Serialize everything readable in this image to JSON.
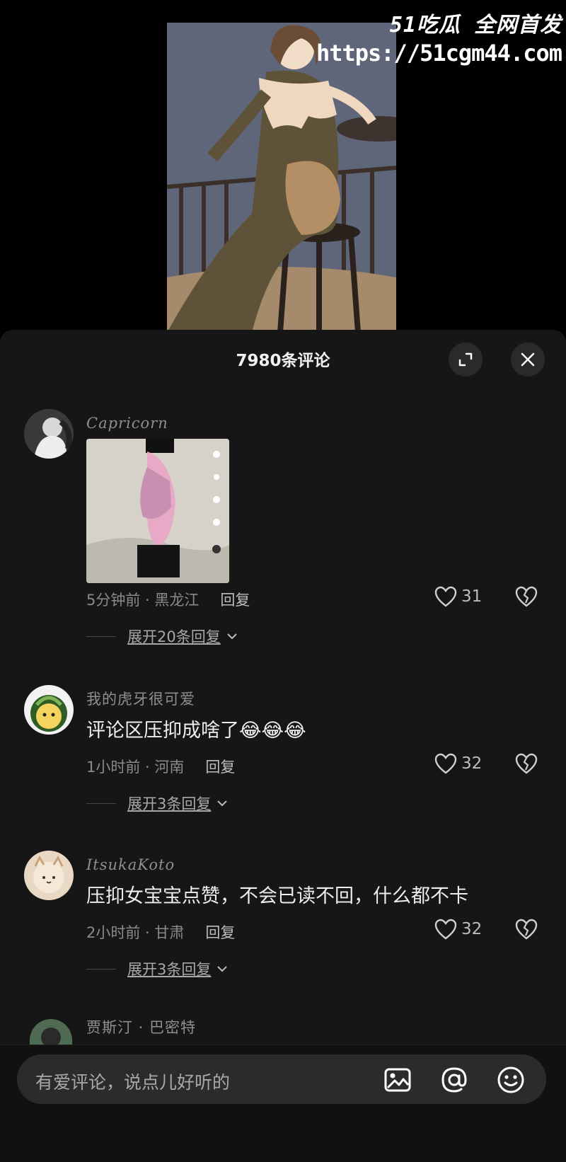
{
  "watermark": {
    "brand": "51吃瓜 全网首发",
    "url": "https://51cgm44.com"
  },
  "sheet": {
    "title": "7980条评论"
  },
  "comments": [
    {
      "user": "Capricorn",
      "text": "",
      "time": "5分钟前 · 黑龙江",
      "reply": "回复",
      "likes": "31",
      "expand": "展开20条回复"
    },
    {
      "user": "我的虎牙很可爱",
      "text": "评论区压抑成啥了😂😂😂",
      "time": "1小时前 · 河南",
      "reply": "回复",
      "likes": "32",
      "expand": "展开3条回复"
    },
    {
      "user": "ItsukaKoto",
      "text": "压抑女宝宝点赞，不会已读不回，什么都不卡",
      "time": "2小时前 · 甘肃",
      "reply": "回复",
      "likes": "32",
      "expand": "展开3条回复"
    },
    {
      "user": "贾斯汀 · 巴密特"
    }
  ],
  "input": {
    "placeholder": "有爱评论，说点儿好听的"
  },
  "icons": {
    "expand": "expand-icon",
    "close": "close-icon",
    "heart": "heart-icon",
    "dislike": "broken-heart-icon",
    "image": "image-icon",
    "mention": "at-icon",
    "emoji": "emoji-icon",
    "chevron": "chevron-down-icon"
  }
}
